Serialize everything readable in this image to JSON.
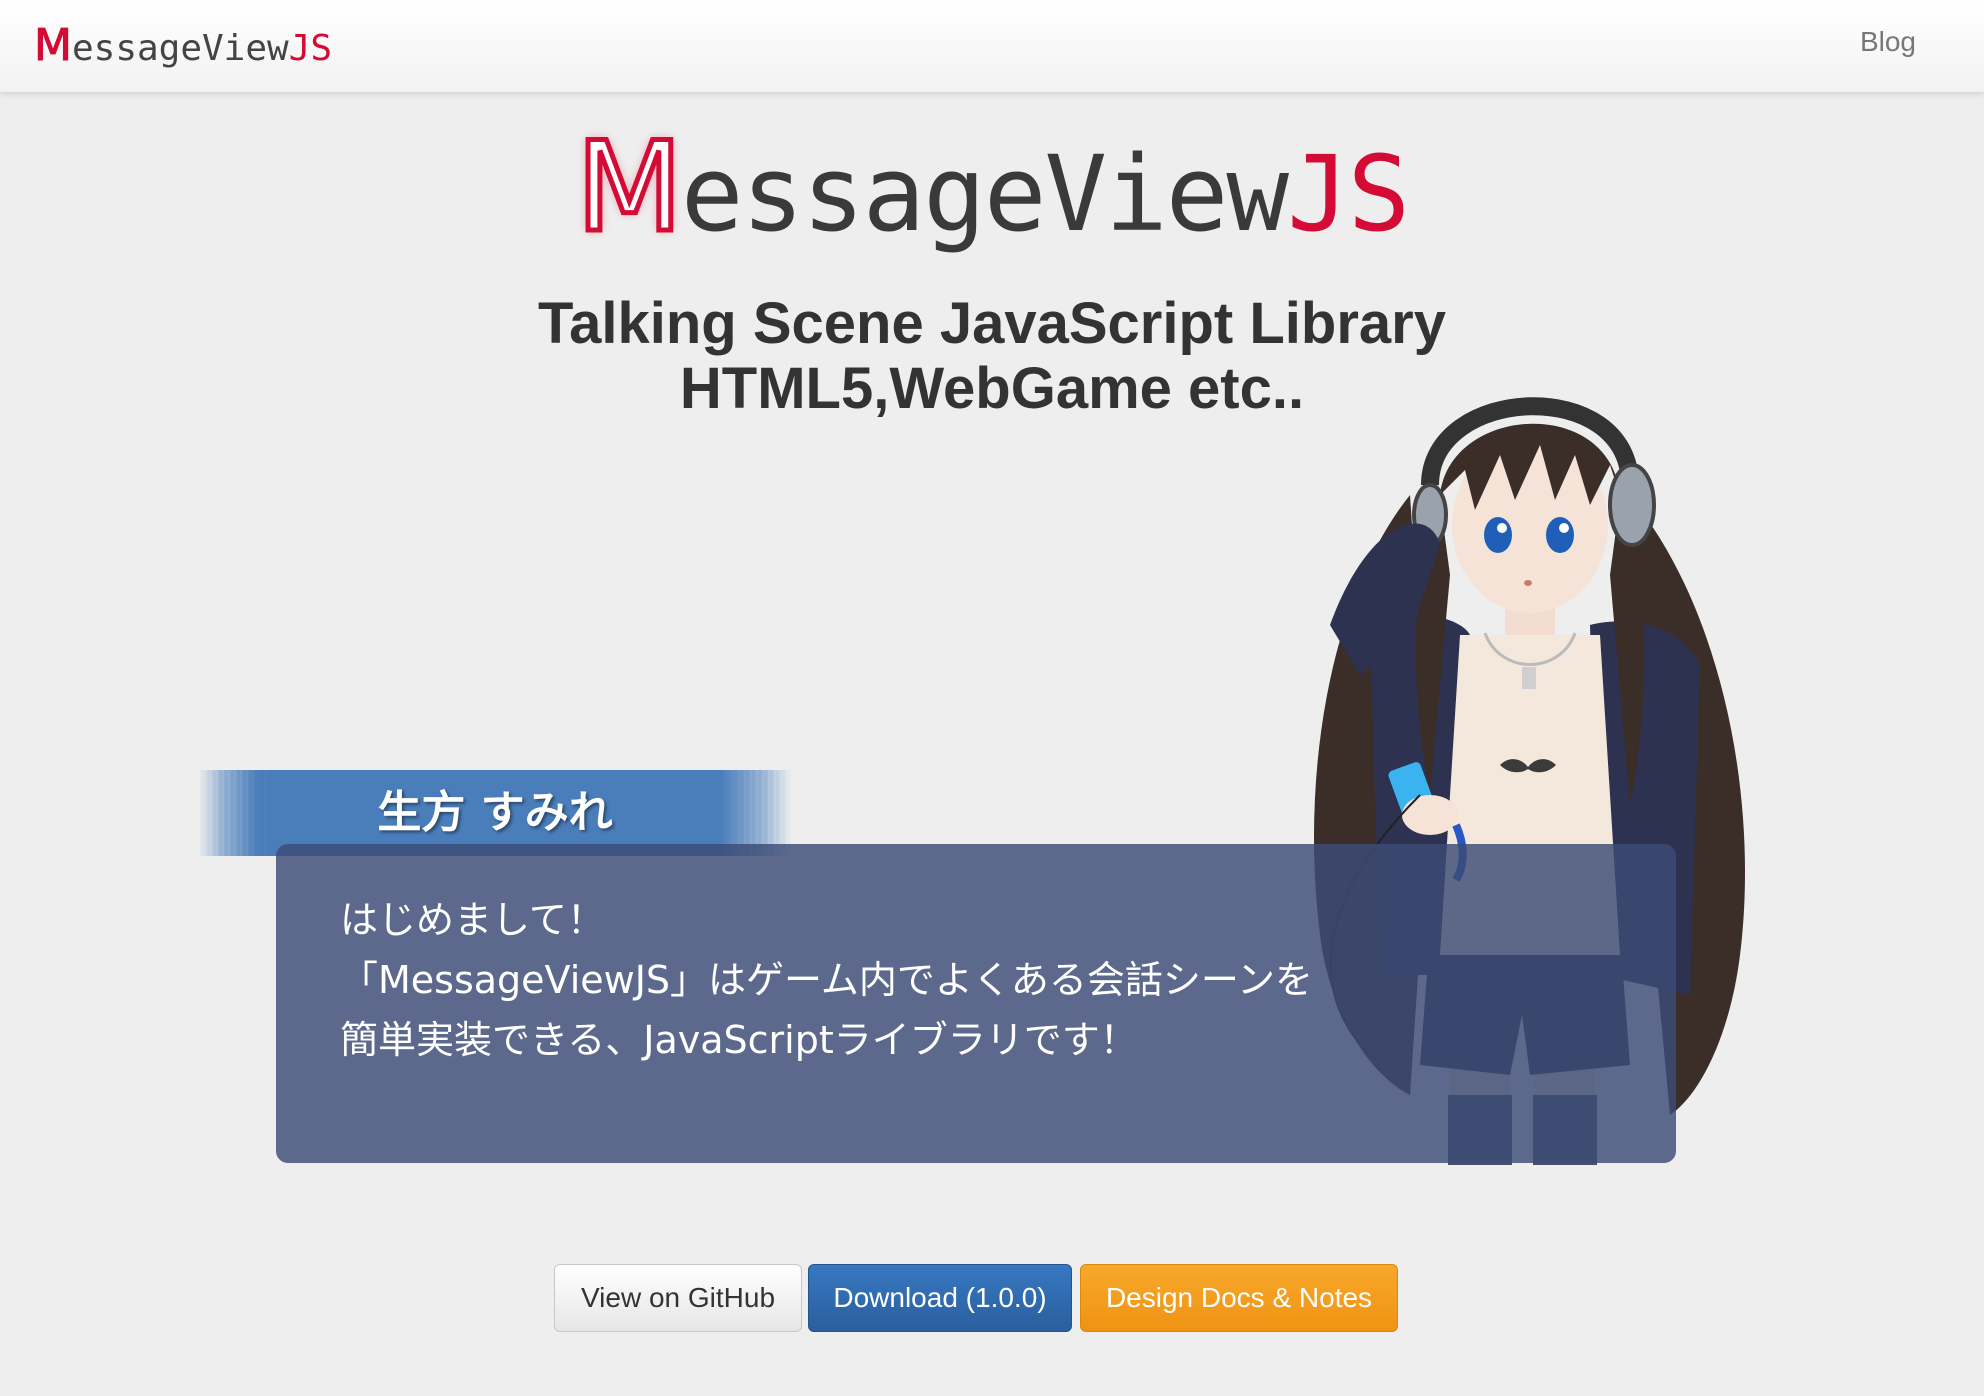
{
  "navbar": {
    "brand_m": "M",
    "brand_rest": "essageView",
    "brand_js": "JS",
    "blog_link": "Blog"
  },
  "hero": {
    "logo_m": "M",
    "logo_rest": "essageView",
    "logo_js": "JS",
    "tagline_line1": "Talking Scene JavaScript Library",
    "tagline_line2": "HTML5,WebGame etc.."
  },
  "dialogue": {
    "speaker_name": "生方 すみれ",
    "message_lines": [
      "はじめまして！",
      "「MessageViewJS」はゲーム内でよくある会話シーンを",
      "簡単実装できる、JavaScriptライブラリです！"
    ]
  },
  "buttons": {
    "github_label": "View on GitHub",
    "download_label": "Download (1.0.0)",
    "docs_label": "Design Docs & Notes"
  },
  "colors": {
    "brand_red": "#d40b35",
    "primary_blue": "#2a5f9e",
    "warning_orange": "#ef9314",
    "message_box_bg": "#3c4c76"
  }
}
